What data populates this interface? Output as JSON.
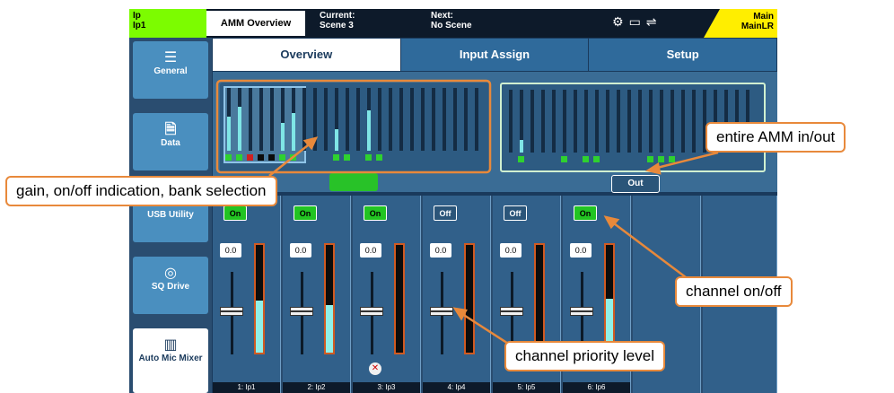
{
  "status": {
    "channel_id": [
      "Ip",
      "Ip1"
    ],
    "screen_name": "AMM Overview",
    "current_label": "Current:",
    "current_scene": "Scene 3",
    "next_label": "Next:",
    "next_scene": "No Scene",
    "mix_id": [
      "Main",
      "MainLR"
    ]
  },
  "sidebar": {
    "items": [
      {
        "label": "General",
        "icon": "list-icon"
      },
      {
        "label": "Data",
        "icon": "usb-document-icon"
      },
      {
        "label": "USB Utility",
        "icon": "usb-icon"
      },
      {
        "label": "SQ Drive",
        "icon": "sq-drive-icon"
      },
      {
        "label": "Auto Mic Mixer",
        "icon": "automixer-icon",
        "active": true
      }
    ]
  },
  "tabs": [
    {
      "label": "Overview",
      "active": true
    },
    {
      "label": "Input Assign",
      "active": false
    },
    {
      "label": "Setup",
      "active": false
    }
  ],
  "overview": {
    "amm_out_label": "Out",
    "bank_button_label": ""
  },
  "channels": [
    {
      "name": "1: Ip1",
      "state": "On",
      "priority": "0.0",
      "meter": 0.48
    },
    {
      "name": "2: Ip2",
      "state": "On",
      "priority": "0.0",
      "meter": 0.44
    },
    {
      "name": "3: Ip3",
      "state": "On",
      "priority": "0.0",
      "meter": 0.0,
      "muted": true
    },
    {
      "name": "4: Ip4",
      "state": "Off",
      "priority": "0.0",
      "meter": 0.0
    },
    {
      "name": "5: Ip5",
      "state": "Off",
      "priority": "0.0",
      "meter": 0.0
    },
    {
      "name": "6: Ip6",
      "state": "On",
      "priority": "0.0",
      "meter": 0.5
    }
  ],
  "callouts": {
    "gain": "gain, on/off indication, bank selection",
    "amm": "entire AMM in/out",
    "onoff": "channel on/off",
    "priority": "channel priority level"
  },
  "colors": {
    "accent_callout": "#e8893b",
    "on_green": "#22c422",
    "meter_cyan": "#8ff0e8"
  }
}
